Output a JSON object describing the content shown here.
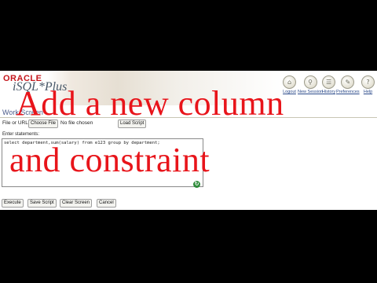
{
  "header": {
    "brand": "ORACLE",
    "product": "iSQL*Plus",
    "nav": [
      {
        "label": "Logout",
        "icon": "logout-icon",
        "glyph": "⌂"
      },
      {
        "label": "New Session",
        "icon": "new-session-icon",
        "glyph": "⚲"
      },
      {
        "label": "History",
        "icon": "history-icon",
        "glyph": "☰"
      },
      {
        "label": "Preferences",
        "icon": "preferences-icon",
        "glyph": "✎"
      },
      {
        "label": "Help",
        "icon": "help-icon",
        "glyph": "?"
      }
    ]
  },
  "workspace": {
    "title": "Work Screen",
    "file_label": "File or URL",
    "choose_file": "Choose File",
    "no_file": "No file chosen",
    "load_script": "Load Script",
    "enter_label": "Enter statements:",
    "sql": "select department,sum(salary) from e123 group by department;",
    "buttons": {
      "execute": "Execute",
      "save": "Save Script",
      "clear": "Clear Screen",
      "cancel": "Cancel"
    }
  },
  "overlay": {
    "line1": "Add a new column",
    "line2": "and constraint"
  },
  "colors": {
    "caption": "#e8141a",
    "brand": "#c4161c"
  }
}
